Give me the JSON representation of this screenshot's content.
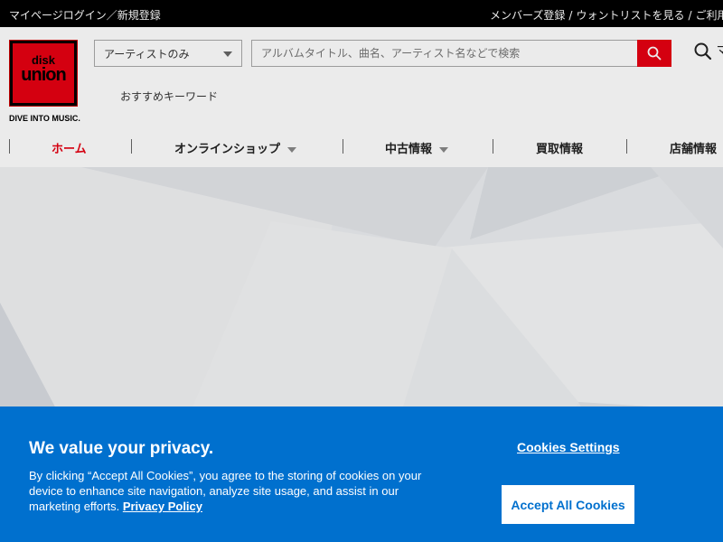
{
  "topbar": {
    "left_links": [
      "マイページログイン",
      "新規登録"
    ],
    "left_sep": "／",
    "right_links": [
      "メンバーズ登録",
      "ウォントリストを見る",
      "ご利用"
    ],
    "right_sep": "/"
  },
  "logo": {
    "line1": "disk",
    "line2": "union",
    "tagline": "DIVE INTO MUSIC."
  },
  "search": {
    "scope_selected": "アーティストのみ",
    "placeholder": "アルバムタイトル、曲名、アーティスト名などで検索"
  },
  "user_area_label": "マ",
  "keywords_label": "おすすめキーワード",
  "nav": {
    "items": [
      {
        "label": "ホーム",
        "active": true,
        "dropdown": false
      },
      {
        "label": "オンラインショップ",
        "active": false,
        "dropdown": true
      },
      {
        "label": "中古情報",
        "active": false,
        "dropdown": true
      },
      {
        "label": "買取情報",
        "active": false,
        "dropdown": false
      },
      {
        "label": "店舗情報",
        "active": false,
        "dropdown": false
      }
    ]
  },
  "cookie_banner": {
    "title": "We value your privacy.",
    "body": "By clicking “Accept All Cookies”, you agree to the storing of cookies on your device to enhance site navigation, analyze site usage, and assist in our marketing efforts.",
    "privacy_link": "Privacy Policy",
    "settings_label": "Cookies Settings",
    "accept_label": "Accept All Cookies"
  },
  "colors": {
    "brand_red": "#e60012",
    "banner_blue": "#0070ce",
    "topbar_black": "#000000"
  },
  "icons": [
    "search-icon",
    "user-icon",
    "chevron-down-icon"
  ]
}
